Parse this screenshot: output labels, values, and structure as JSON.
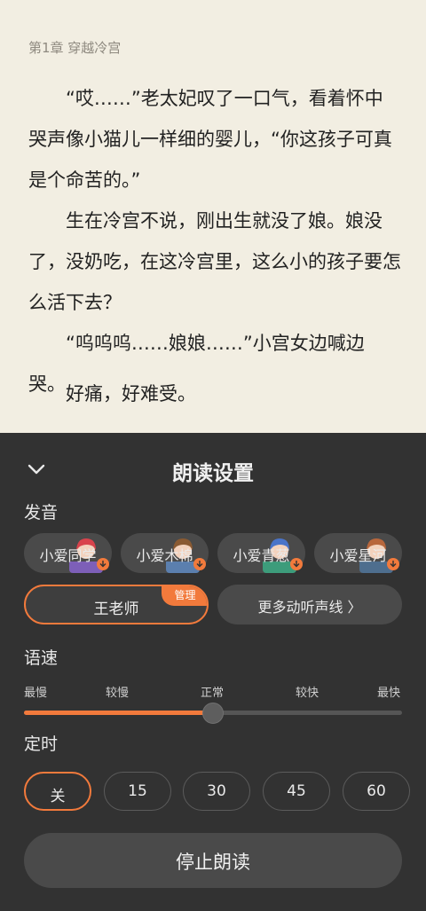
{
  "reader": {
    "chapter_title": "第1章 穿越冷宫",
    "paragraphs": [
      "“哎……”老太妃叹了一口气，看着怀中哭声像小猫儿一样细的婴儿，“你这孩子可真是个命苦的。”",
      "生在冷宫不说，刚出生就没了娘。娘没了，没奶吃，在这冷宫里，这么小的孩子要怎么活下去？",
      "“呜呜呜……娘娘……”小宫女边喊边哭。",
      "好痛，好难受。"
    ]
  },
  "panel": {
    "title": "朗读设置",
    "collapse_icon": "chevron-down-icon",
    "voice_section": "发音",
    "voices": [
      {
        "name": "小爱同学",
        "hair": "#d9434c",
        "shirt": "#7d5fb8"
      },
      {
        "name": "小爱木棉",
        "hair": "#8a5a32",
        "shirt": "#5b7fae"
      },
      {
        "name": "小爱青葱",
        "hair": "#4a74c9",
        "shirt": "#3d9c7b"
      },
      {
        "name": "小爱星河",
        "hair": "#b8673c",
        "shirt": "#4e6e8e"
      }
    ],
    "selected_voice": "王老师",
    "manage_label": "管理",
    "more_voices_label": "更多动听声线 〉",
    "speed_section": "语速",
    "speed_ticks": [
      "最慢",
      "较慢",
      "正常",
      "较快",
      "最快"
    ],
    "speed_value": 0.5,
    "timer_section": "定时",
    "timer_options": [
      "关",
      "15",
      "30",
      "45",
      "60"
    ],
    "timer_selected": "关",
    "stop_label": "停止朗读",
    "accent_color": "#f27a3c"
  }
}
